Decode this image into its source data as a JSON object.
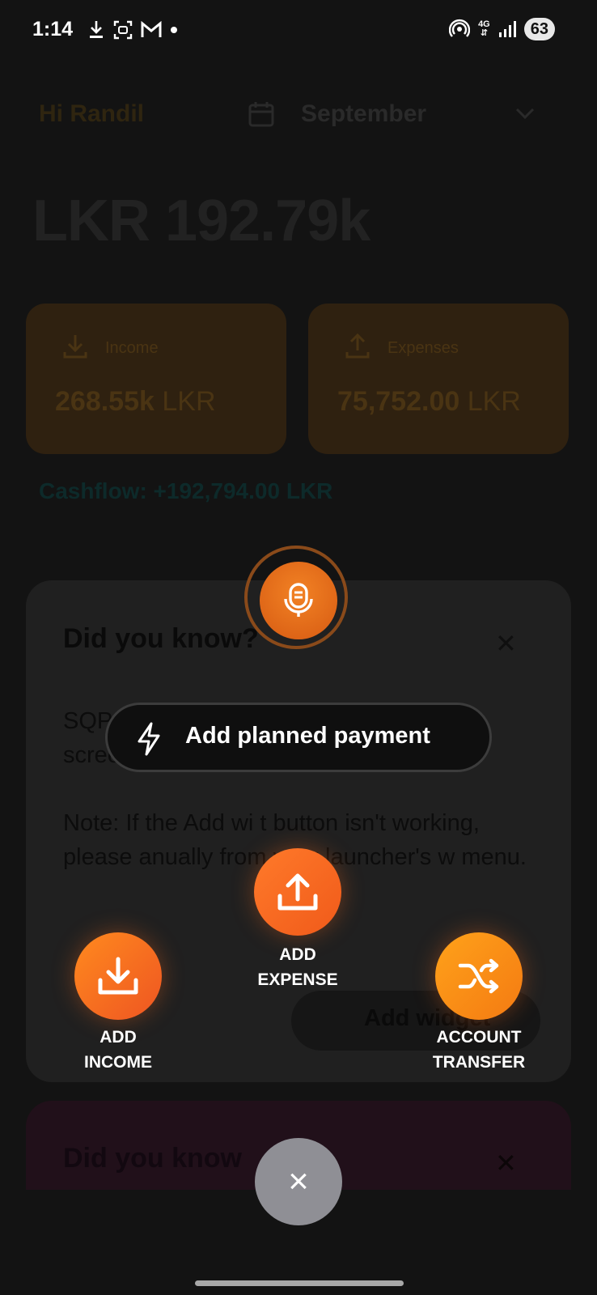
{
  "status_bar": {
    "time": "1:14",
    "network": "4G",
    "battery": "63",
    "icons": [
      "download-icon",
      "screenshot-icon",
      "gmail-icon",
      "dot-icon",
      "hotspot-icon",
      "signal-icon"
    ]
  },
  "background_app": {
    "greeting": "Hi Randil",
    "month": "September",
    "balance": "LKR 192.79k",
    "income": {
      "label": "Income",
      "value": "268.55k",
      "unit": "LKR"
    },
    "expenses": {
      "label": "Expenses",
      "value": "75,752.00",
      "unit": "LKR"
    },
    "cashflow": "Cashflow: +192,794.00 LKR",
    "tip_card": {
      "title": "Did you know?",
      "paragraph_1": "SQP                                              t allo                                              ust one tap from your home screen.",
      "paragraph_2": "Note: If the Add wi     t button isn't working, please          anually from your launcher's w        menu.",
      "add_widget": "Add widget"
    },
    "tip_card_2": {
      "title": "Did you know"
    }
  },
  "fab_menu": {
    "voice_icon": "microphone-icon",
    "planned_payment": "Add planned payment",
    "add_expense": [
      "ADD",
      "EXPENSE"
    ],
    "add_income": [
      "ADD",
      "INCOME"
    ],
    "account_transfer": [
      "ACCOUNT",
      "TRANSFER"
    ],
    "close_symbol": "×"
  },
  "colors": {
    "accent_orange": "#f07020",
    "overlay_bg": "#131313",
    "close_button": "#8f8f95"
  }
}
